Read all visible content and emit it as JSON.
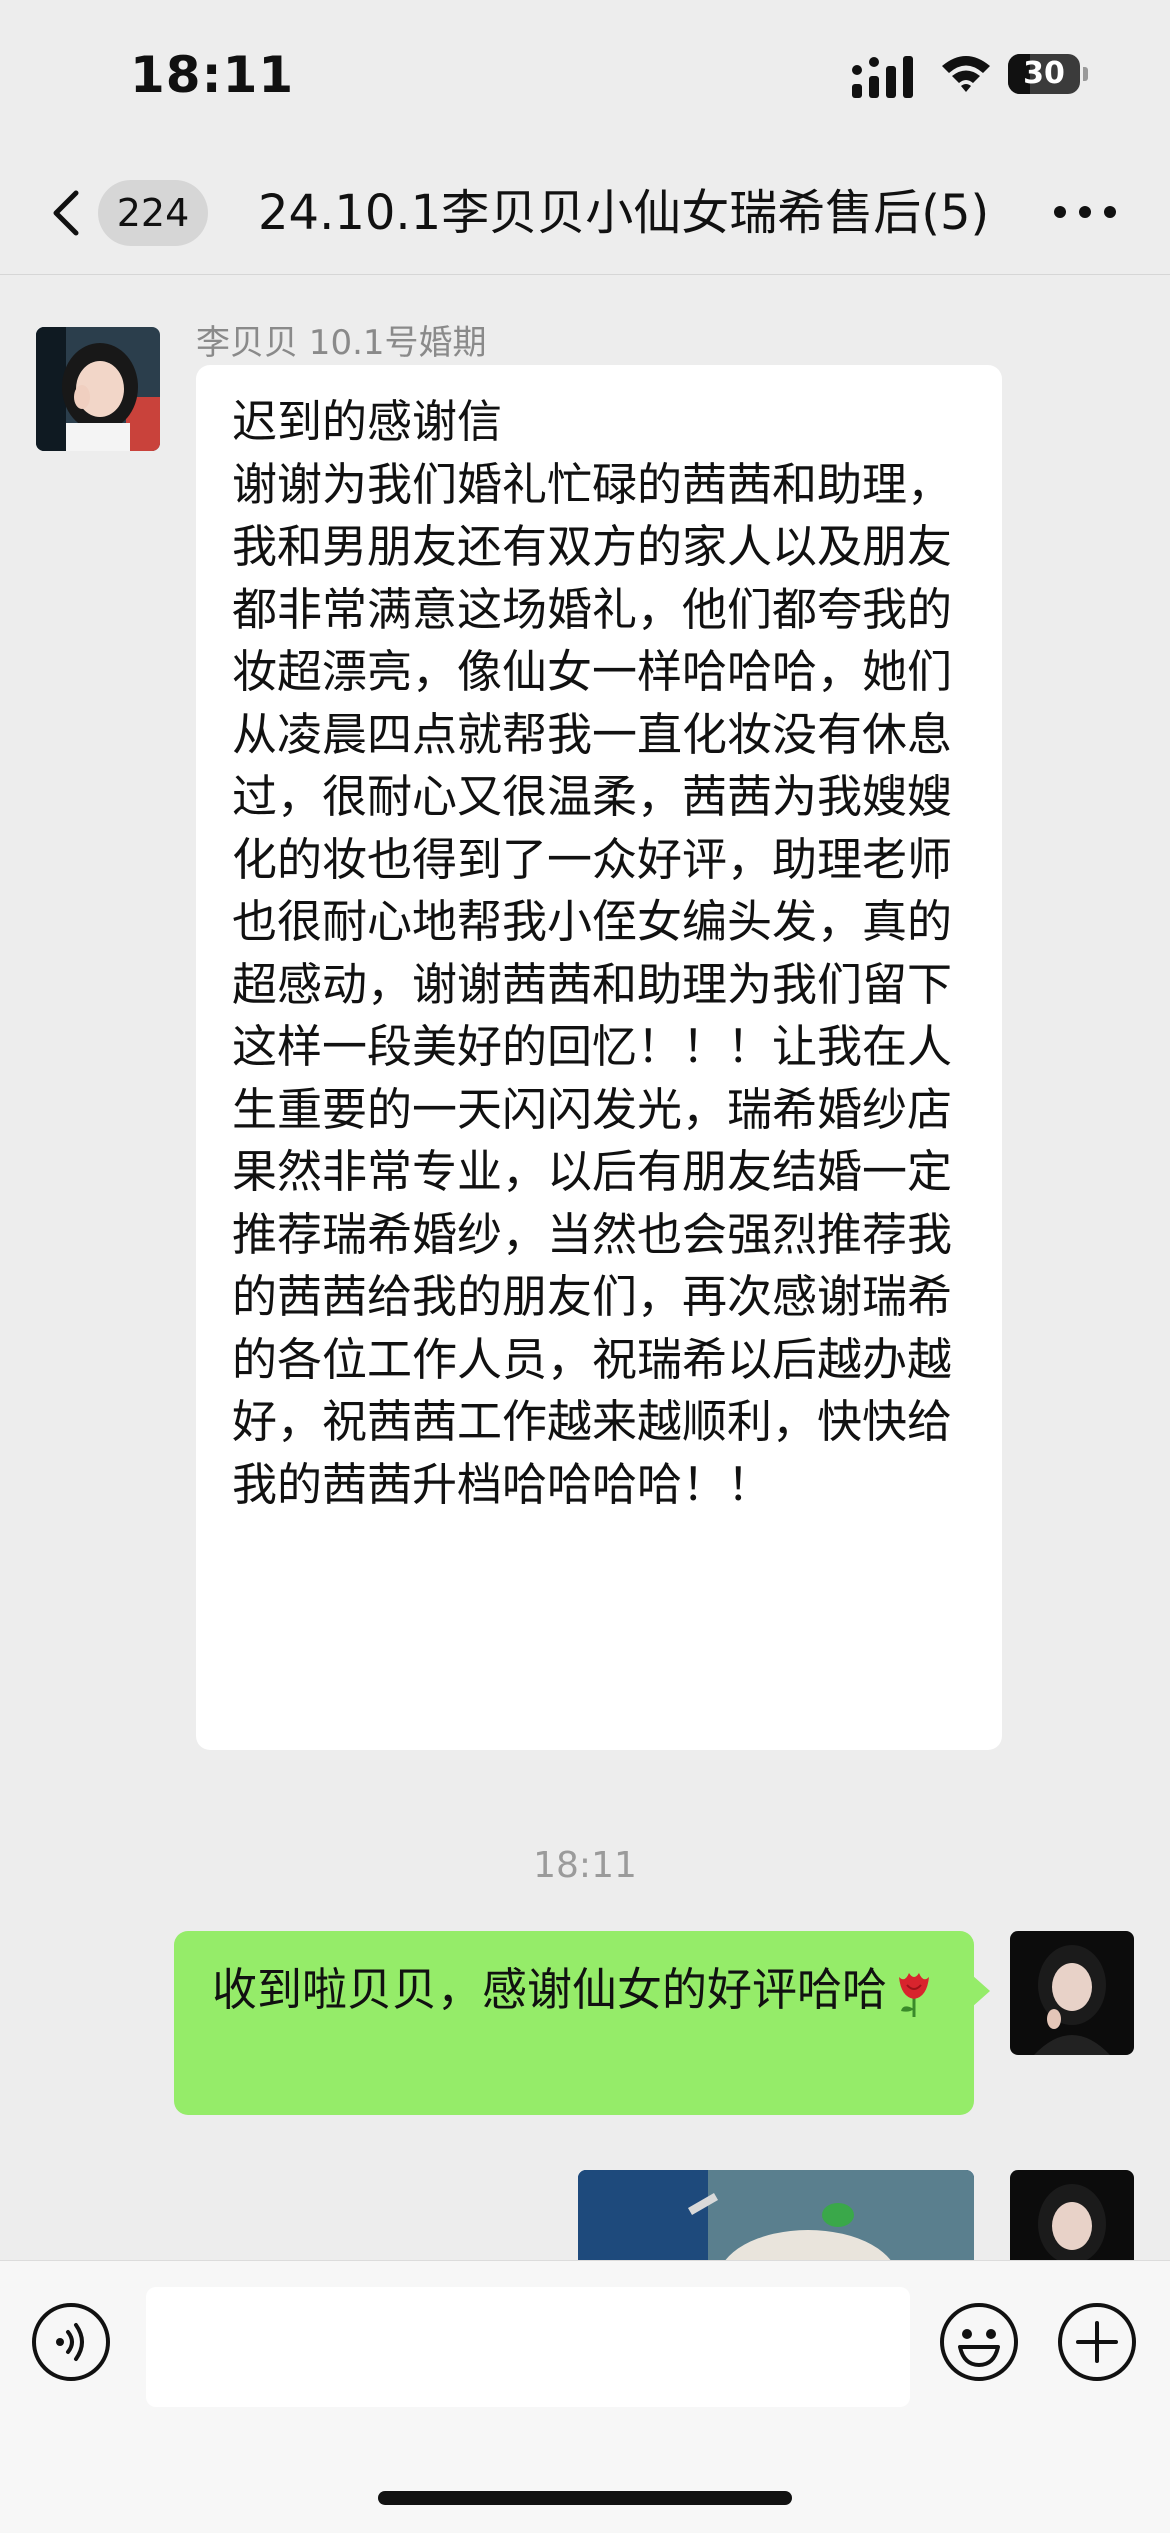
{
  "status_bar": {
    "time": "18:11",
    "battery": "30",
    "battery_level_percent": 30
  },
  "nav": {
    "unread_count": "224",
    "title": "24.10.1李贝贝小仙女瑞希售后(5)",
    "back_icon": "chevron-left-icon",
    "more_icon": "more-dots-icon"
  },
  "messages": {
    "incoming": {
      "sender": "李贝贝 10.1号婚期",
      "text": "迟到的感谢信\n谢谢为我们婚礼忙碌的茜茜和助理，我和男朋友还有双方的家人以及朋友都非常满意这场婚礼，他们都夸我的妆超漂亮，像仙女一样哈哈哈，她们从凌晨四点就帮我一直化妆没有休息过，很耐心又很温柔，茜茜为我嫂嫂化的妆也得到了一众好评，助理老师也很耐心地帮我小侄女编头发，真的超感动，谢谢茜茜和助理为我们留下这样一段美好的回忆！！！让我在人生重要的一天闪闪发光，瑞希婚纱店果然非常专业，以后有朋友结婚一定推荐瑞希婚纱，当然也会强烈推荐我的茜茜给我的朋友们，再次感谢瑞希的各位工作人员，祝瑞希以后越办越好，祝茜茜工作越来越顺利，快快给我的茜茜升档哈哈哈哈！！"
    },
    "timestamp": "18:11",
    "outgoing": {
      "text": "收到啦贝贝，感谢仙女的好评哈哈",
      "emoji_icon": "rose-icon"
    }
  },
  "input_bar": {
    "voice_icon": "voice-icon",
    "emoji_icon": "smiley-icon",
    "plus_icon": "plus-circle-icon",
    "input_value": ""
  },
  "colors": {
    "background": "#ededed",
    "outgoing_bubble": "#95ec69",
    "incoming_bubble": "#ffffff",
    "meta_text": "#8a8a8a"
  }
}
